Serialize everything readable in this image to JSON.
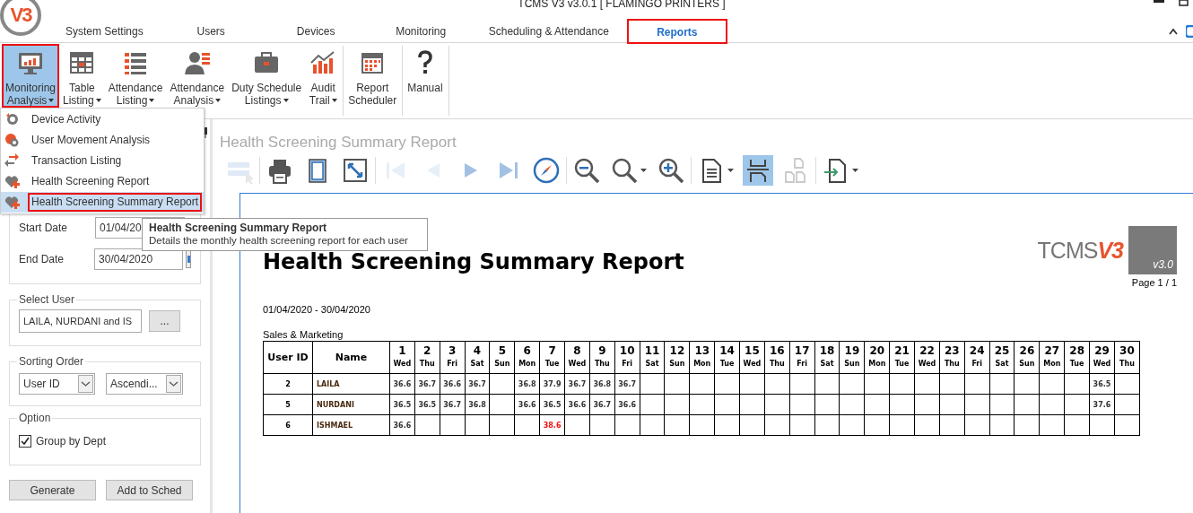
{
  "window": {
    "title": "TCMS V3 v3.0.1 [ FLAMINGO PRINTERS ]",
    "logo_text": "V3"
  },
  "tabs": [
    {
      "label": "System Settings",
      "selected": false,
      "annotated": false
    },
    {
      "label": "Users",
      "selected": false,
      "annotated": false
    },
    {
      "label": "Devices",
      "selected": false,
      "annotated": false
    },
    {
      "label": "Monitoring",
      "selected": false,
      "annotated": false
    },
    {
      "label": "Scheduling & Attendance",
      "selected": false,
      "annotated": false
    },
    {
      "label": "Reports",
      "selected": true,
      "annotated": true
    }
  ],
  "ribbon": [
    [
      {
        "label": [
          "Monitoring",
          "Analysis"
        ],
        "dropdown": true,
        "selected": true,
        "annotated": true
      },
      {
        "label": [
          "Table",
          "Listing"
        ],
        "dropdown": true,
        "selected": false,
        "annotated": false
      },
      {
        "label": [
          "Attendance",
          "Listing"
        ],
        "dropdown": true,
        "selected": false,
        "annotated": false
      },
      {
        "label": [
          "Attendance",
          "Analysis"
        ],
        "dropdown": true,
        "selected": false,
        "annotated": false
      },
      {
        "label": [
          "Duty Schedule",
          "Listings"
        ],
        "dropdown": true,
        "selected": false,
        "annotated": false
      },
      {
        "label": [
          "Audit",
          "Trail"
        ],
        "dropdown": true,
        "selected": false,
        "annotated": false
      }
    ],
    [
      {
        "label": [
          "Report",
          "Scheduler"
        ],
        "dropdown": false,
        "selected": false,
        "annotated": false
      }
    ],
    [
      {
        "label": [
          "Manual"
        ],
        "dropdown": false,
        "selected": false,
        "annotated": false
      }
    ]
  ],
  "menu": [
    {
      "label": "Device Activity",
      "selected": false,
      "annotated": false
    },
    {
      "label": "User Movement Analysis",
      "selected": false,
      "annotated": false
    },
    {
      "label": "Transaction Listing",
      "selected": false,
      "annotated": false
    },
    {
      "label": "Health Screening Report",
      "selected": false,
      "annotated": false
    },
    {
      "label": "Health Screening Summary Report",
      "selected": true,
      "annotated": true
    }
  ],
  "tooltip": {
    "title": "Health Screening Summary Report",
    "text": "Details the monthly health screening report for each user"
  },
  "left_panel": {
    "start_date": {
      "label": "Start Date",
      "value": "01/04/20"
    },
    "end_date": {
      "label": "End Date",
      "value": "30/04/2020"
    },
    "select_user": {
      "title": "Select User",
      "value": "LAILA, NURDANI and IS",
      "button": "..."
    },
    "sorting": {
      "title": "Sorting Order",
      "field": "User ID",
      "direction": "Ascendi..."
    },
    "option": {
      "title": "Option",
      "label": "Group by Dept",
      "checked": true
    },
    "buttons": [
      "Generate",
      "Add to Sched"
    ]
  },
  "report": {
    "heading": "Health Screening Summary Report",
    "toolbar": [
      [
        {
          "disabled": true,
          "selected": false,
          "dropdown": false
        }
      ],
      [
        {
          "disabled": false,
          "selected": false,
          "dropdown": false
        },
        {
          "disabled": false,
          "selected": false,
          "dropdown": false
        },
        {
          "disabled": false,
          "selected": false,
          "dropdown": false
        }
      ],
      [
        {
          "disabled": true,
          "selected": false,
          "dropdown": false
        },
        {
          "disabled": true,
          "selected": false,
          "dropdown": false
        },
        {
          "disabled": false,
          "selected": false,
          "dropdown": false
        },
        {
          "disabled": false,
          "selected": false,
          "dropdown": false
        },
        {
          "disabled": false,
          "selected": false,
          "dropdown": false
        }
      ],
      [
        {
          "disabled": false,
          "selected": false,
          "dropdown": false
        },
        {
          "disabled": false,
          "selected": false,
          "dropdown": true
        },
        {
          "disabled": false,
          "selected": false,
          "dropdown": false
        }
      ],
      [
        {
          "disabled": false,
          "selected": false,
          "dropdown": true
        },
        {
          "disabled": false,
          "selected": true,
          "dropdown": false
        },
        {
          "disabled": true,
          "selected": false,
          "dropdown": false
        }
      ],
      [
        {
          "disabled": false,
          "selected": false,
          "dropdown": true
        }
      ]
    ],
    "page": {
      "title": "Health Screening Summary Report",
      "logo": [
        "TCMS",
        "V3"
      ],
      "version": "v3.0",
      "page_number": "Page 1 / 1",
      "date_range": "01/04/2020 - 30/04/2020",
      "department": "Sales & Marketing",
      "columns": [
        "User ID",
        "Name"
      ],
      "days": [
        {
          "day": "1",
          "weekday": "Wed"
        },
        {
          "day": "2",
          "weekday": "Thu"
        },
        {
          "day": "3",
          "weekday": "Fri"
        },
        {
          "day": "4",
          "weekday": "Sat"
        },
        {
          "day": "5",
          "weekday": "Sun"
        },
        {
          "day": "6",
          "weekday": "Mon"
        },
        {
          "day": "7",
          "weekday": "Tue"
        },
        {
          "day": "8",
          "weekday": "Wed"
        },
        {
          "day": "9",
          "weekday": "Thu"
        },
        {
          "day": "10",
          "weekday": "Fri"
        },
        {
          "day": "11",
          "weekday": "Sat"
        },
        {
          "day": "12",
          "weekday": "Sun"
        },
        {
          "day": "13",
          "weekday": "Mon"
        },
        {
          "day": "14",
          "weekday": "Tue"
        },
        {
          "day": "15",
          "weekday": "Wed"
        },
        {
          "day": "16",
          "weekday": "Thu"
        },
        {
          "day": "17",
          "weekday": "Fri"
        },
        {
          "day": "18",
          "weekday": "Sat"
        },
        {
          "day": "19",
          "weekday": "Sun"
        },
        {
          "day": "20",
          "weekday": "Mon"
        },
        {
          "day": "21",
          "weekday": "Tue"
        },
        {
          "day": "22",
          "weekday": "Wed"
        },
        {
          "day": "23",
          "weekday": "Thu"
        },
        {
          "day": "24",
          "weekday": "Fri"
        },
        {
          "day": "25",
          "weekday": "Sat"
        },
        {
          "day": "26",
          "weekday": "Sun"
        },
        {
          "day": "27",
          "weekday": "Mon"
        },
        {
          "day": "28",
          "weekday": "Tue"
        },
        {
          "day": "29",
          "weekday": "Wed"
        },
        {
          "day": "30",
          "weekday": "Thu"
        }
      ],
      "rows": [
        {
          "user_id": "2",
          "name": "LAILA",
          "readings": [
            {
              "kind": "reading",
              "value": "36.6",
              "high": false
            },
            {
              "kind": "reading",
              "value": "36.7",
              "high": false
            },
            {
              "kind": "reading",
              "value": "36.6",
              "high": false
            },
            {
              "kind": "reading",
              "value": "36.7",
              "high": false
            },
            {
              "kind": "empty"
            },
            {
              "kind": "reading",
              "value": "36.8",
              "high": false
            },
            {
              "kind": "reading",
              "value": "37.9",
              "high": false
            },
            {
              "kind": "reading",
              "value": "36.7",
              "high": false
            },
            {
              "kind": "reading",
              "value": "36.8",
              "high": false
            },
            {
              "kind": "reading",
              "value": "36.7",
              "high": false
            },
            {
              "kind": "empty"
            },
            {
              "kind": "empty"
            },
            {
              "kind": "empty"
            },
            {
              "kind": "empty"
            },
            {
              "kind": "empty"
            },
            {
              "kind": "empty"
            },
            {
              "kind": "empty"
            },
            {
              "kind": "empty"
            },
            {
              "kind": "empty"
            },
            {
              "kind": "empty"
            },
            {
              "kind": "empty"
            },
            {
              "kind": "empty"
            },
            {
              "kind": "empty"
            },
            {
              "kind": "empty"
            },
            {
              "kind": "empty"
            },
            {
              "kind": "empty"
            },
            {
              "kind": "empty"
            },
            {
              "kind": "empty"
            },
            {
              "kind": "reading",
              "value": "36.5",
              "high": false
            },
            {
              "kind": "empty"
            }
          ]
        },
        {
          "user_id": "5",
          "name": "NURDANI",
          "readings": [
            {
              "kind": "reading",
              "value": "36.5",
              "high": false
            },
            {
              "kind": "reading",
              "value": "36.5",
              "high": false
            },
            {
              "kind": "reading",
              "value": "36.7",
              "high": false
            },
            {
              "kind": "reading",
              "value": "36.8",
              "high": false
            },
            {
              "kind": "empty"
            },
            {
              "kind": "reading",
              "value": "36.6",
              "high": false
            },
            {
              "kind": "reading",
              "value": "36.5",
              "high": false
            },
            {
              "kind": "reading",
              "value": "36.6",
              "high": false
            },
            {
              "kind": "reading",
              "value": "36.7",
              "high": false
            },
            {
              "kind": "reading",
              "value": "36.6",
              "high": false
            },
            {
              "kind": "empty"
            },
            {
              "kind": "empty"
            },
            {
              "kind": "empty"
            },
            {
              "kind": "empty"
            },
            {
              "kind": "empty"
            },
            {
              "kind": "empty"
            },
            {
              "kind": "empty"
            },
            {
              "kind": "empty"
            },
            {
              "kind": "empty"
            },
            {
              "kind": "empty"
            },
            {
              "kind": "empty"
            },
            {
              "kind": "empty"
            },
            {
              "kind": "empty"
            },
            {
              "kind": "empty"
            },
            {
              "kind": "empty"
            },
            {
              "kind": "empty"
            },
            {
              "kind": "empty"
            },
            {
              "kind": "empty"
            },
            {
              "kind": "reading",
              "value": "37.6",
              "high": false
            },
            {
              "kind": "empty"
            }
          ]
        },
        {
          "user_id": "6",
          "name": "ISHMAEL",
          "readings": [
            {
              "kind": "reading",
              "value": "36.6",
              "high": false
            },
            {
              "kind": "empty"
            },
            {
              "kind": "empty"
            },
            {
              "kind": "empty"
            },
            {
              "kind": "empty"
            },
            {
              "kind": "empty"
            },
            {
              "kind": "reading",
              "value": "38.6",
              "high": true
            },
            {
              "kind": "empty"
            },
            {
              "kind": "empty"
            },
            {
              "kind": "empty"
            },
            {
              "kind": "empty"
            },
            {
              "kind": "empty"
            },
            {
              "kind": "empty"
            },
            {
              "kind": "empty"
            },
            {
              "kind": "empty"
            },
            {
              "kind": "empty"
            },
            {
              "kind": "empty"
            },
            {
              "kind": "empty"
            },
            {
              "kind": "empty"
            },
            {
              "kind": "empty"
            },
            {
              "kind": "empty"
            },
            {
              "kind": "empty"
            },
            {
              "kind": "empty"
            },
            {
              "kind": "empty"
            },
            {
              "kind": "empty"
            },
            {
              "kind": "empty"
            },
            {
              "kind": "empty"
            },
            {
              "kind": "empty"
            },
            {
              "kind": "empty"
            },
            {
              "kind": "empty"
            }
          ]
        }
      ]
    }
  }
}
